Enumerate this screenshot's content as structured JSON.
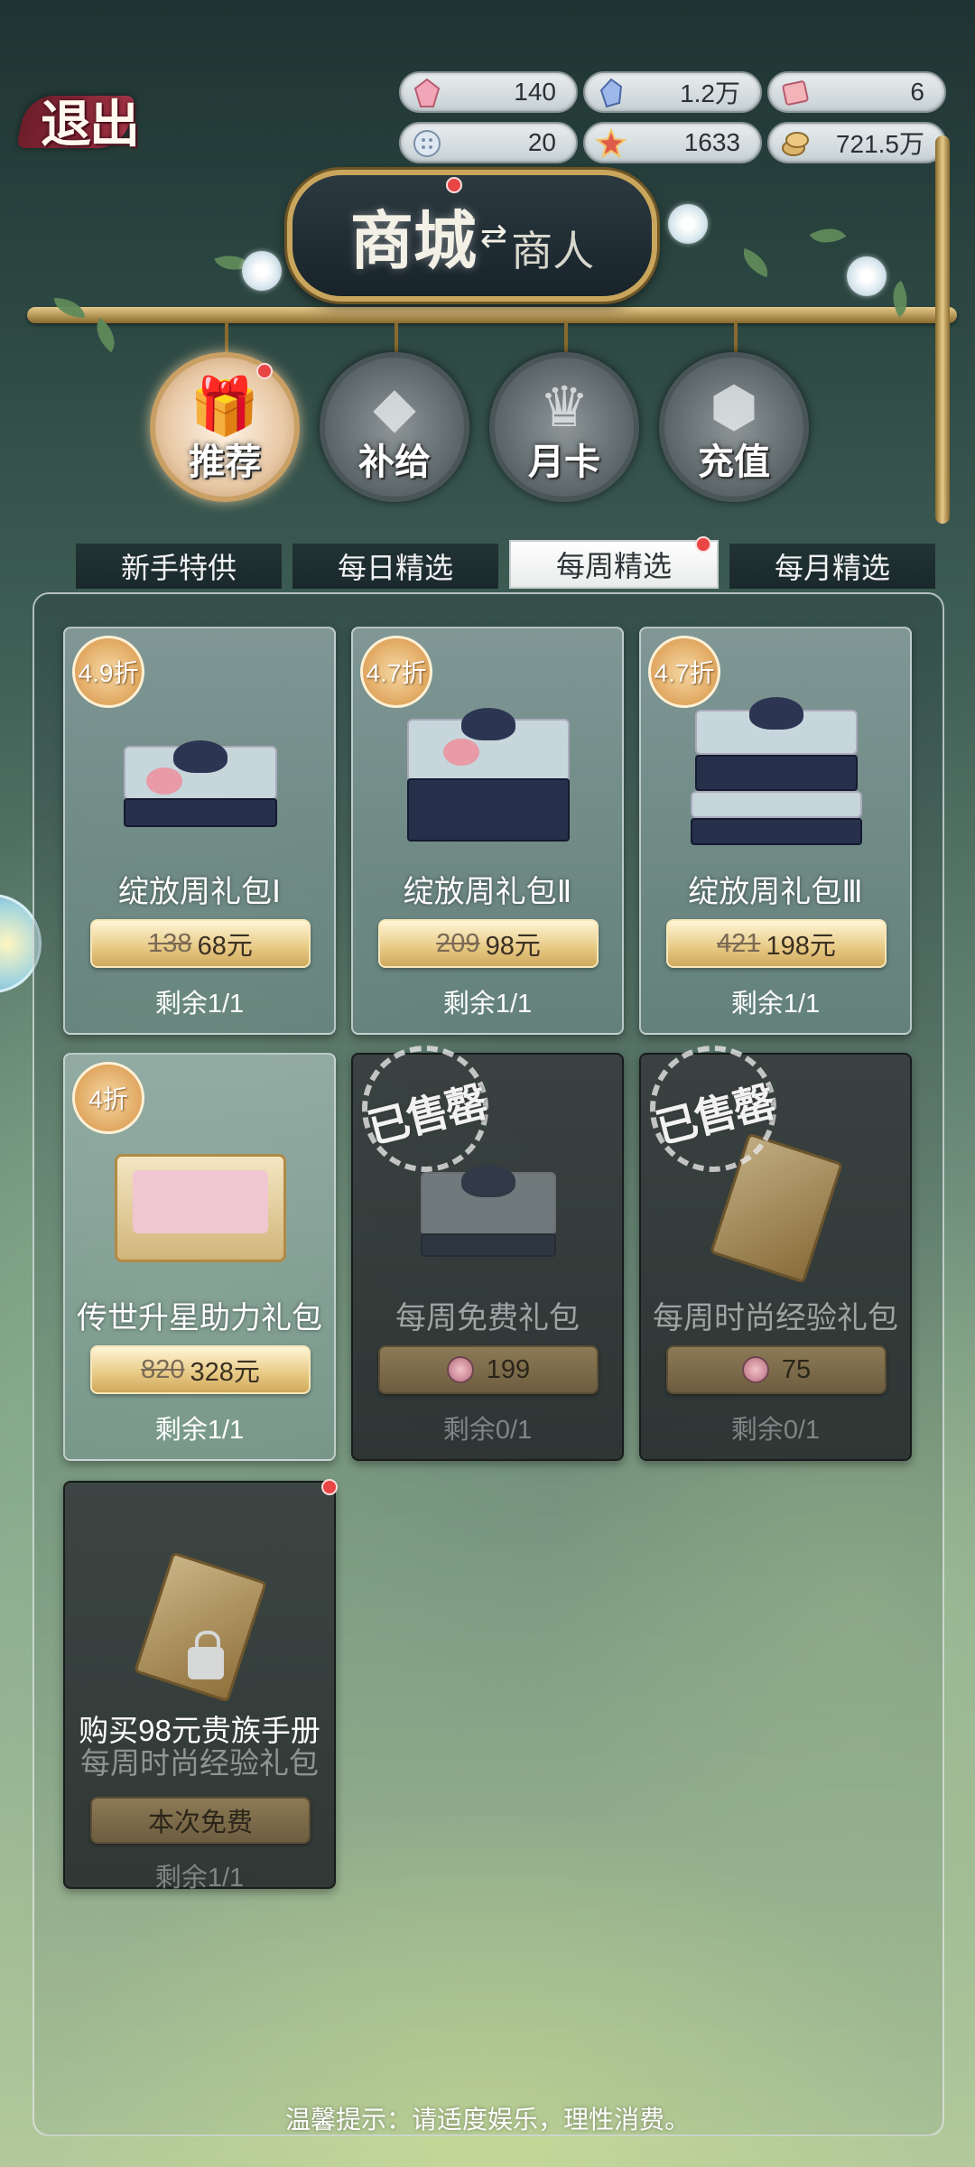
{
  "top_bar": {
    "exit_label": "退出",
    "currencies": [
      {
        "icon": "pink-crystal-icon",
        "value": "140"
      },
      {
        "icon": "blue-crystal-icon",
        "value": "1.2万"
      },
      {
        "icon": "ticket-icon",
        "value": "6"
      },
      {
        "icon": "button-token-icon",
        "value": "20"
      },
      {
        "icon": "star-gem-icon",
        "value": "1633"
      },
      {
        "icon": "gold-coin-icon",
        "value": "721.5万"
      }
    ]
  },
  "sign": {
    "main": "商城",
    "arrow": "⇄",
    "sub": "商人"
  },
  "categories": [
    {
      "label": "推荐",
      "glyph": "🎁",
      "active": true,
      "icon": "gift-box-icon",
      "has_dot": true
    },
    {
      "label": "补给",
      "glyph": "◆",
      "active": false,
      "icon": "crystal-icon",
      "has_dot": false
    },
    {
      "label": "月卡",
      "glyph": "♛",
      "active": false,
      "icon": "crown-card-icon",
      "has_dot": false
    },
    {
      "label": "充值",
      "glyph": "⬢",
      "active": false,
      "icon": "gem-recharge-icon",
      "has_dot": false
    }
  ],
  "tabs": [
    {
      "label": "新手特供",
      "active": false
    },
    {
      "label": "每日精选",
      "active": false
    },
    {
      "label": "每周精选",
      "active": true
    },
    {
      "label": "每月精选",
      "active": false
    }
  ],
  "products": [
    {
      "discount": "4.9折",
      "title": "绽放周礼包Ⅰ",
      "old_price": "138",
      "price": "68元",
      "remaining": "剩余1/1"
    },
    {
      "discount": "4.7折",
      "title": "绽放周礼包Ⅱ",
      "old_price": "209",
      "price": "98元",
      "remaining": "剩余1/1"
    },
    {
      "discount": "4.7折",
      "title": "绽放周礼包Ⅲ",
      "old_price": "421",
      "price": "198元",
      "remaining": "剩余1/1"
    },
    {
      "discount": "4折",
      "title": "传世升星助力礼包",
      "old_price": "820",
      "price": "328元",
      "remaining": "剩余1/1"
    },
    {
      "sold_out": "已售罄",
      "title": "每周免费礼包",
      "gem_price": "199",
      "remaining": "剩余0/1"
    },
    {
      "sold_out": "已售罄",
      "title": "每周时尚经验礼包",
      "gem_price": "75",
      "remaining": "剩余0/1"
    }
  ],
  "locked_product": {
    "line1": "购买98元贵族手册",
    "line2": "每周时尚经验礼包",
    "button": "本次免费",
    "remaining": "剩余1/1"
  },
  "footer": "温馨提示：请适度娱乐，理性消费。"
}
